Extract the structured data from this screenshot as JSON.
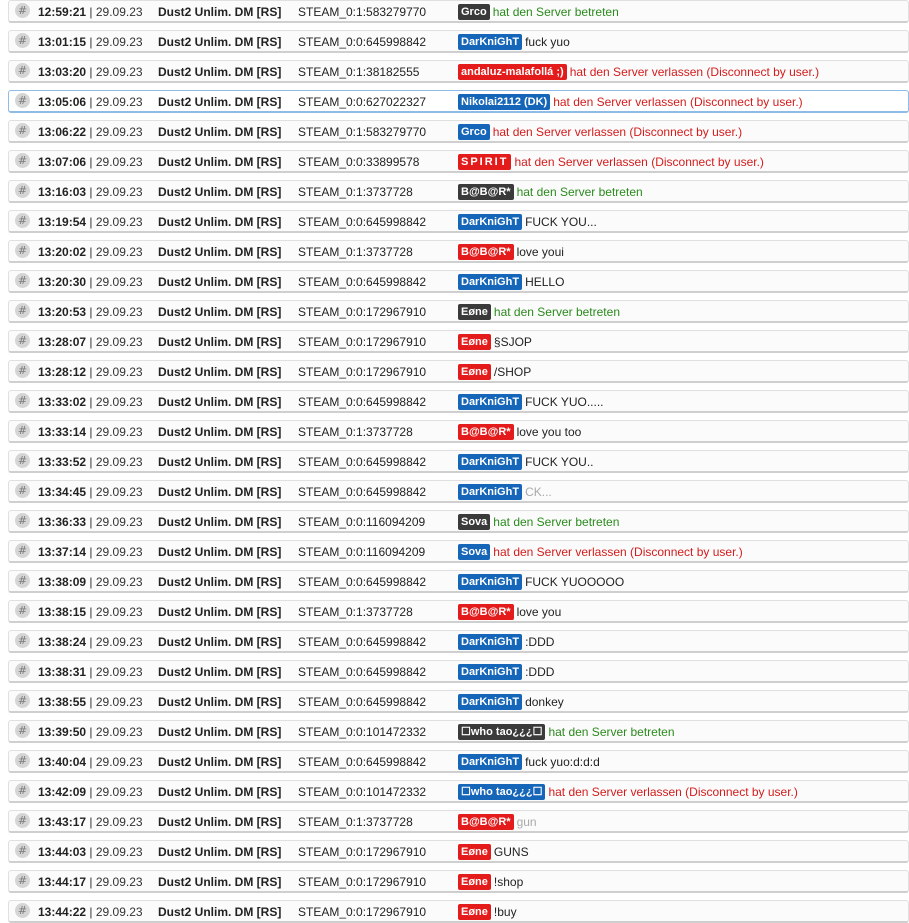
{
  "server_name": "Dust2 Unlim. DM [RS]",
  "hash_symbol": "#",
  "date_separator": " | ",
  "colors": {
    "join": "#2a8a1c",
    "leave": "#d41c1c",
    "badge_blue": "#1565b8",
    "badge_red": "#e31b1b",
    "badge_dark": "#3a3a3a"
  },
  "entries": [
    {
      "time": "12:59:21",
      "date": "29.09.23",
      "steam": "STEAM_0:1:583279770",
      "player": "Grco",
      "badge": "dark",
      "text": "hat den Server betreten",
      "type": "join"
    },
    {
      "time": "13:01:15",
      "date": "29.09.23",
      "steam": "STEAM_0:0:645998842",
      "player": "DarKniGhT",
      "badge": "blue",
      "text": "fuck yuo",
      "type": "chat"
    },
    {
      "time": "13:03:20",
      "date": "29.09.23",
      "steam": "STEAM_0:1:38182555",
      "player": "andaluz-malafollá ;)",
      "badge": "red",
      "text": "hat den Server verlassen (Disconnect by user.)",
      "type": "leave"
    },
    {
      "time": "13:05:06",
      "date": "29.09.23",
      "steam": "STEAM_0:0:627022327",
      "player": "Nikolai2112 (DK)",
      "badge": "blue",
      "text": "hat den Server verlassen (Disconnect by user.)",
      "type": "leave"
    },
    {
      "time": "13:06:22",
      "date": "29.09.23",
      "steam": "STEAM_0:1:583279770",
      "player": "Grco",
      "badge": "blue",
      "text": "hat den Server verlassen (Disconnect by user.)",
      "type": "leave"
    },
    {
      "time": "13:07:06",
      "date": "29.09.23",
      "steam": "STEAM_0:0:33899578",
      "player": "SPIRIT",
      "badge": "red",
      "text": "hat den Server verlassen (Disconnect by user.)",
      "type": "leave"
    },
    {
      "time": "13:16:03",
      "date": "29.09.23",
      "steam": "STEAM_0:1:3737728",
      "player": "B@B@R*",
      "badge": "dark",
      "text": "hat den Server betreten",
      "type": "join"
    },
    {
      "time": "13:19:54",
      "date": "29.09.23",
      "steam": "STEAM_0:0:645998842",
      "player": "DarKniGhT",
      "badge": "blue",
      "text": "FUCK YOU...",
      "type": "chat"
    },
    {
      "time": "13:20:02",
      "date": "29.09.23",
      "steam": "STEAM_0:1:3737728",
      "player": "B@B@R*",
      "badge": "red",
      "text": "love youi",
      "type": "chat"
    },
    {
      "time": "13:20:30",
      "date": "29.09.23",
      "steam": "STEAM_0:0:645998842",
      "player": "DarKniGhT",
      "badge": "blue",
      "text": "HELLO",
      "type": "chat"
    },
    {
      "time": "13:20:53",
      "date": "29.09.23",
      "steam": "STEAM_0:0:172967910",
      "player": "Eøne",
      "badge": "dark",
      "text": "hat den Server betreten",
      "type": "join"
    },
    {
      "time": "13:28:07",
      "date": "29.09.23",
      "steam": "STEAM_0:0:172967910",
      "player": "Eøne",
      "badge": "red",
      "text": "§SJOP",
      "type": "chat"
    },
    {
      "time": "13:28:12",
      "date": "29.09.23",
      "steam": "STEAM_0:0:172967910",
      "player": "Eøne",
      "badge": "red",
      "text": "/SHOP",
      "type": "chat"
    },
    {
      "time": "13:33:02",
      "date": "29.09.23",
      "steam": "STEAM_0:0:645998842",
      "player": "DarKniGhT",
      "badge": "blue",
      "text": "FUCK YUO.....",
      "type": "chat"
    },
    {
      "time": "13:33:14",
      "date": "29.09.23",
      "steam": "STEAM_0:1:3737728",
      "player": "B@B@R*",
      "badge": "red",
      "text": "love you too",
      "type": "chat"
    },
    {
      "time": "13:33:52",
      "date": "29.09.23",
      "steam": "STEAM_0:0:645998842",
      "player": "DarKniGhT",
      "badge": "blue",
      "text": "FUCK YOU..",
      "type": "chat"
    },
    {
      "time": "13:34:45",
      "date": "29.09.23",
      "steam": "STEAM_0:0:645998842",
      "player": "DarKniGhT",
      "badge": "blue",
      "text": "CK...",
      "type": "muted"
    },
    {
      "time": "13:36:33",
      "date": "29.09.23",
      "steam": "STEAM_0:0:116094209",
      "player": "Sova",
      "badge": "dark",
      "text": "hat den Server betreten",
      "type": "join"
    },
    {
      "time": "13:37:14",
      "date": "29.09.23",
      "steam": "STEAM_0:0:116094209",
      "player": "Sova",
      "badge": "blue",
      "text": "hat den Server verlassen (Disconnect by user.)",
      "type": "leave"
    },
    {
      "time": "13:38:09",
      "date": "29.09.23",
      "steam": "STEAM_0:0:645998842",
      "player": "DarKniGhT",
      "badge": "blue",
      "text": "FUCK YUOOOOO",
      "type": "chat"
    },
    {
      "time": "13:38:15",
      "date": "29.09.23",
      "steam": "STEAM_0:1:3737728",
      "player": "B@B@R*",
      "badge": "red",
      "text": "love you",
      "type": "chat"
    },
    {
      "time": "13:38:24",
      "date": "29.09.23",
      "steam": "STEAM_0:0:645998842",
      "player": "DarKniGhT",
      "badge": "blue",
      "text": ":DDD",
      "type": "chat"
    },
    {
      "time": "13:38:31",
      "date": "29.09.23",
      "steam": "STEAM_0:0:645998842",
      "player": "DarKniGhT",
      "badge": "blue",
      "text": ":DDD",
      "type": "chat"
    },
    {
      "time": "13:38:55",
      "date": "29.09.23",
      "steam": "STEAM_0:0:645998842",
      "player": "DarKniGhT",
      "badge": "blue",
      "text": "donkey",
      "type": "chat"
    },
    {
      "time": "13:39:50",
      "date": "29.09.23",
      "steam": "STEAM_0:0:101472332",
      "player": "☐who tao¿¿¿☐",
      "badge": "dark",
      "text": "hat den Server betreten",
      "type": "join"
    },
    {
      "time": "13:40:04",
      "date": "29.09.23",
      "steam": "STEAM_0:0:645998842",
      "player": "DarKniGhT",
      "badge": "blue",
      "text": "fuck yuo:d:d:d",
      "type": "chat"
    },
    {
      "time": "13:42:09",
      "date": "29.09.23",
      "steam": "STEAM_0:0:101472332",
      "player": "☐who tao¿¿¿☐",
      "badge": "blue",
      "text": "hat den Server verlassen (Disconnect by user.)",
      "type": "leave"
    },
    {
      "time": "13:43:17",
      "date": "29.09.23",
      "steam": "STEAM_0:1:3737728",
      "player": "B@B@R*",
      "badge": "red",
      "text": "gun",
      "type": "muted"
    },
    {
      "time": "13:44:03",
      "date": "29.09.23",
      "steam": "STEAM_0:0:172967910",
      "player": "Eøne",
      "badge": "red",
      "text": "GUNS",
      "type": "chat"
    },
    {
      "time": "13:44:17",
      "date": "29.09.23",
      "steam": "STEAM_0:0:172967910",
      "player": "Eøne",
      "badge": "red",
      "text": "!shop",
      "type": "chat"
    },
    {
      "time": "13:44:22",
      "date": "29.09.23",
      "steam": "STEAM_0:0:172967910",
      "player": "Eøne",
      "badge": "red",
      "text": "!buy",
      "type": "chat"
    }
  ]
}
